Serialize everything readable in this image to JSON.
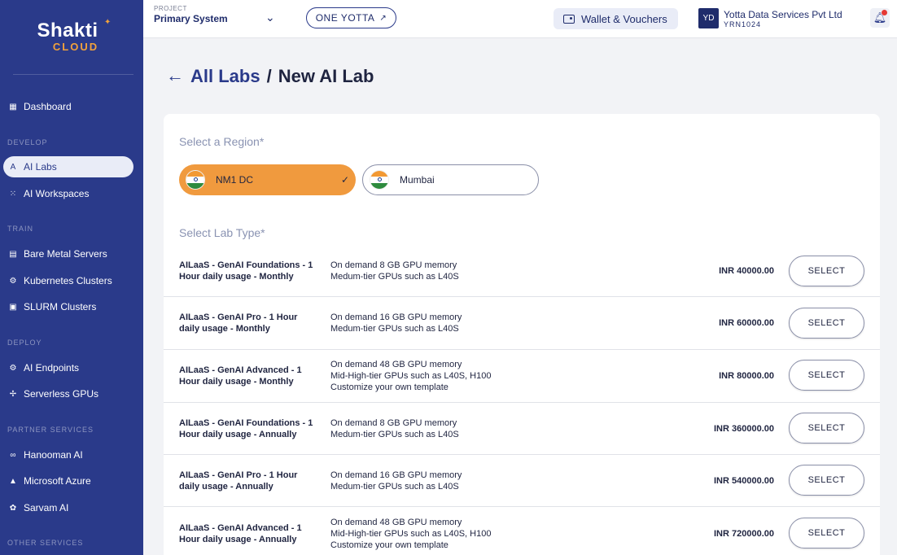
{
  "brand": {
    "name": "Shakti",
    "sub": "CLOUD"
  },
  "sidebar": {
    "items": [
      {
        "label": "Dashboard",
        "icon": "dashboard-icon"
      },
      {
        "label": "AI Labs",
        "icon": "ai-labs-icon",
        "active": true
      },
      {
        "label": "AI Workspaces",
        "icon": "workspaces-icon"
      },
      {
        "label": "Bare Metal Servers",
        "icon": "server-icon"
      },
      {
        "label": "Kubernetes Clusters",
        "icon": "kubernetes-icon"
      },
      {
        "label": "SLURM Clusters",
        "icon": "slurm-icon"
      },
      {
        "label": "AI Endpoints",
        "icon": "endpoints-icon"
      },
      {
        "label": "Serverless GPUs",
        "icon": "serverless-icon"
      },
      {
        "label": "Hanooman AI",
        "icon": "infinity-icon"
      },
      {
        "label": "Microsoft Azure",
        "icon": "azure-icon"
      },
      {
        "label": "Sarvam AI",
        "icon": "sarvam-icon"
      }
    ],
    "sections": [
      "DEVELOP",
      "TRAIN",
      "DEPLOY",
      "PARTNER SERVICES",
      "OTHER SERVICES"
    ]
  },
  "topbar": {
    "project_label": "PROJECT",
    "project_value": "Primary System",
    "one_yotta": "ONE YOTTA",
    "wallet": "Wallet & Vouchers",
    "avatar": "YD",
    "org_name": "Yotta Data Services Pvt Ltd",
    "org_id": "YRN1024"
  },
  "header": {
    "parent": "All Labs",
    "separator": "/",
    "current": "New AI Lab"
  },
  "region": {
    "label": "Select a Region*",
    "options": [
      {
        "name": "NM1 DC",
        "selected": true
      },
      {
        "name": "Mumbai",
        "selected": false
      }
    ]
  },
  "labtype": {
    "label": "Select Lab Type*",
    "select_label": "SELECT",
    "rows": [
      {
        "name": "AILaaS - GenAI Foundations - 1 Hour daily usage - Monthly",
        "desc": [
          "On demand 8 GB GPU memory",
          "Medum-tier GPUs such as L40S"
        ],
        "price": "INR 40000.00"
      },
      {
        "name": "AILaaS - GenAI Pro - 1 Hour daily usage - Monthly",
        "desc": [
          "On demand 16 GB GPU memory",
          "Medum-tier GPUs such as L40S"
        ],
        "price": "INR 60000.00"
      },
      {
        "name": "AILaaS - GenAI Advanced - 1 Hour daily usage - Monthly",
        "desc": [
          "On demand 48 GB GPU memory",
          "Mid-High-tier GPUs such as L40S, H100",
          "Customize your own template"
        ],
        "price": "INR 80000.00"
      },
      {
        "name": "AILaaS - GenAI Foundations - 1 Hour daily usage - Annually",
        "desc": [
          "On demand 8 GB GPU memory",
          "Medum-tier GPUs such as L40S"
        ],
        "price": "INR 360000.00"
      },
      {
        "name": "AILaaS - GenAI Pro - 1 Hour daily usage - Annually",
        "desc": [
          "On demand 16 GB GPU memory",
          "Medum-tier GPUs such as L40S"
        ],
        "price": "INR 540000.00"
      },
      {
        "name": "AILaaS - GenAI Advanced - 1 Hour daily usage - Annually",
        "desc": [
          "On demand 48 GB GPU memory",
          "Mid-High-tier GPUs such as L40S, H100",
          "Customize your own template"
        ],
        "price": "INR 720000.00"
      }
    ]
  },
  "colors": {
    "sidebar": "#2a3a8a",
    "accent": "#f09a3e",
    "primary_text": "#1f2c6b"
  }
}
